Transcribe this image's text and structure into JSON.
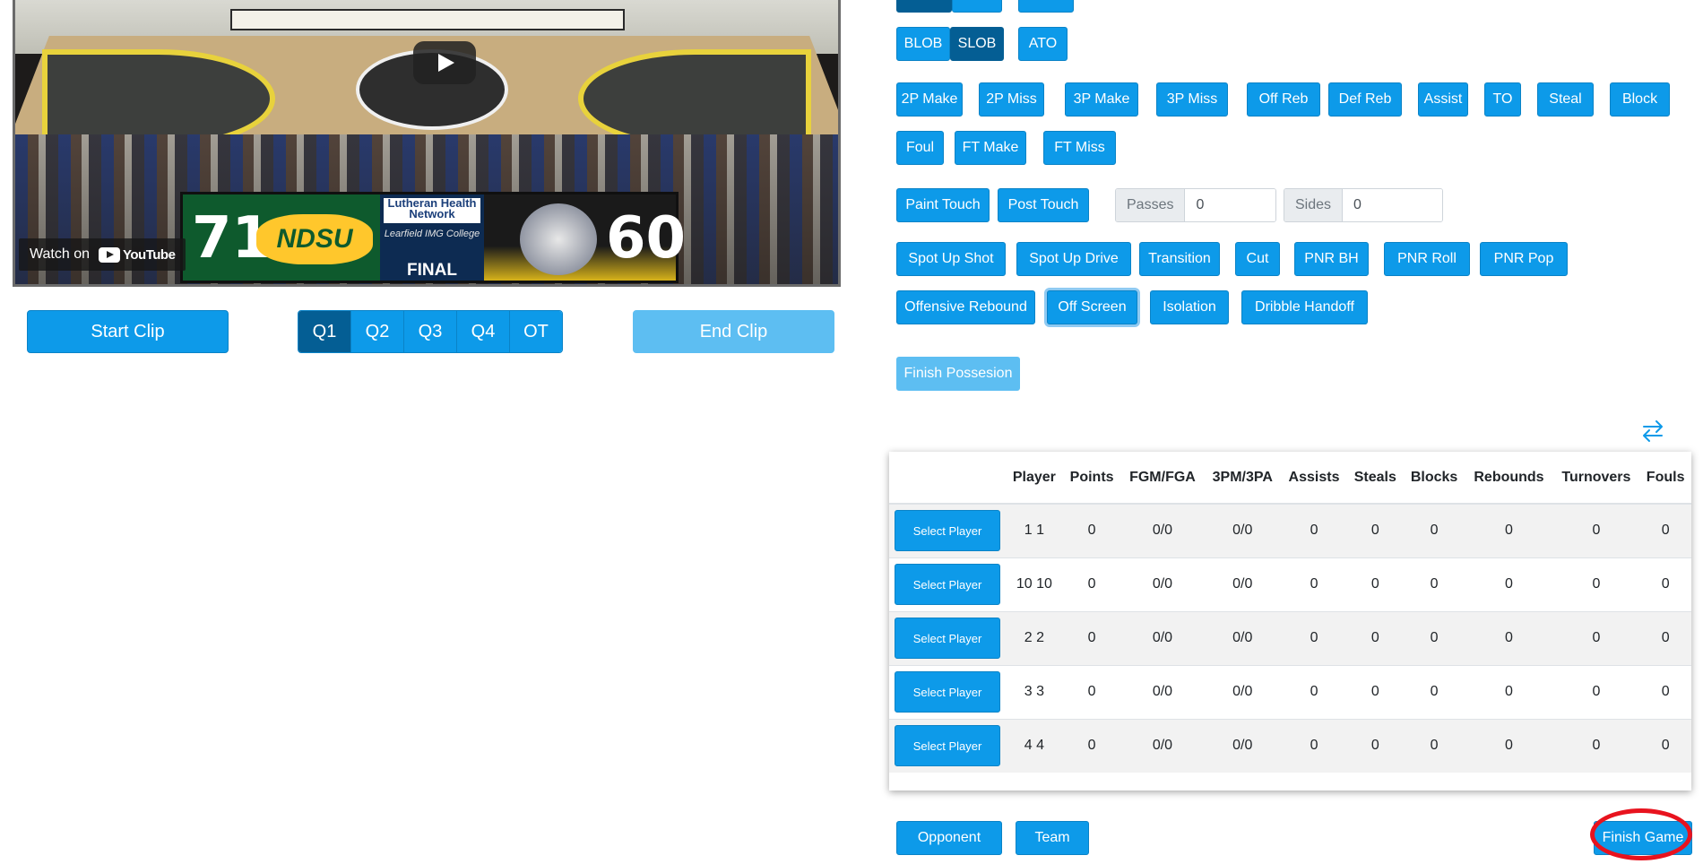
{
  "video": {
    "watch_on": "Watch on",
    "youtube": "YouTube",
    "scoreboard": {
      "home_score": "71",
      "home_logo_text": "NDSU",
      "sponsor": "Lutheran Health Network",
      "sponsor2": "Learfield IMG College",
      "status": "FINAL",
      "away_score": "60"
    }
  },
  "clip_controls": {
    "start_label": "Start Clip",
    "end_label": "End Clip",
    "quarters": [
      "Q1",
      "Q2",
      "Q3",
      "Q4",
      "OT"
    ],
    "active_quarter": "Q1"
  },
  "inbound_buttons": [
    "BLOB",
    "SLOB",
    "ATO"
  ],
  "stat_buttons_row1": [
    "2P Make",
    "2P Miss",
    "3P Make",
    "3P Miss",
    "Off Reb",
    "Def Reb",
    "Assist",
    "TO",
    "Steal",
    "Block"
  ],
  "stat_buttons_row2": [
    "Foul",
    "FT Make",
    "FT Miss"
  ],
  "touch_buttons": [
    "Paint Touch",
    "Post Touch"
  ],
  "passes": {
    "label": "Passes",
    "value": "0"
  },
  "sides": {
    "label": "Sides",
    "value": "0"
  },
  "play_types_row1": [
    "Spot Up Shot",
    "Spot Up Drive",
    "Transition",
    "Cut",
    "PNR BH",
    "PNR Roll",
    "PNR Pop"
  ],
  "play_types_row2": [
    "Offensive Rebound",
    "Off Screen",
    "Isolation",
    "Dribble Handoff"
  ],
  "finish_possession_label": "Finish Possesion",
  "stats_table": {
    "columns": [
      "",
      "Player",
      "Points",
      "FGM/FGA",
      "3PM/3PA",
      "Assists",
      "Steals",
      "Blocks",
      "Rebounds",
      "Turnovers",
      "Fouls"
    ],
    "select_label": "Select Player",
    "rows": [
      [
        "1 1",
        "0",
        "0/0",
        "0/0",
        "0",
        "0",
        "0",
        "0",
        "0",
        "0"
      ],
      [
        "10 10",
        "0",
        "0/0",
        "0/0",
        "0",
        "0",
        "0",
        "0",
        "0",
        "0"
      ],
      [
        "2 2",
        "0",
        "0/0",
        "0/0",
        "0",
        "0",
        "0",
        "0",
        "0",
        "0"
      ],
      [
        "3 3",
        "0",
        "0/0",
        "0/0",
        "0",
        "0",
        "0",
        "0",
        "0",
        "0"
      ],
      [
        "4 4",
        "0",
        "0/0",
        "0/0",
        "0",
        "0",
        "0",
        "0",
        "0",
        "0"
      ]
    ]
  },
  "bottom_buttons": {
    "opponent": "Opponent",
    "team": "Team",
    "finish_game": "Finish Game"
  },
  "colors": {
    "primary": "#0d9ae9",
    "active": "#045e94",
    "disabled": "#5dbef2",
    "highlight_ring": "#e8131e"
  },
  "icons": {
    "swap": "swap-arrows-icon",
    "play": "play-icon",
    "youtube": "youtube-logo-icon"
  }
}
